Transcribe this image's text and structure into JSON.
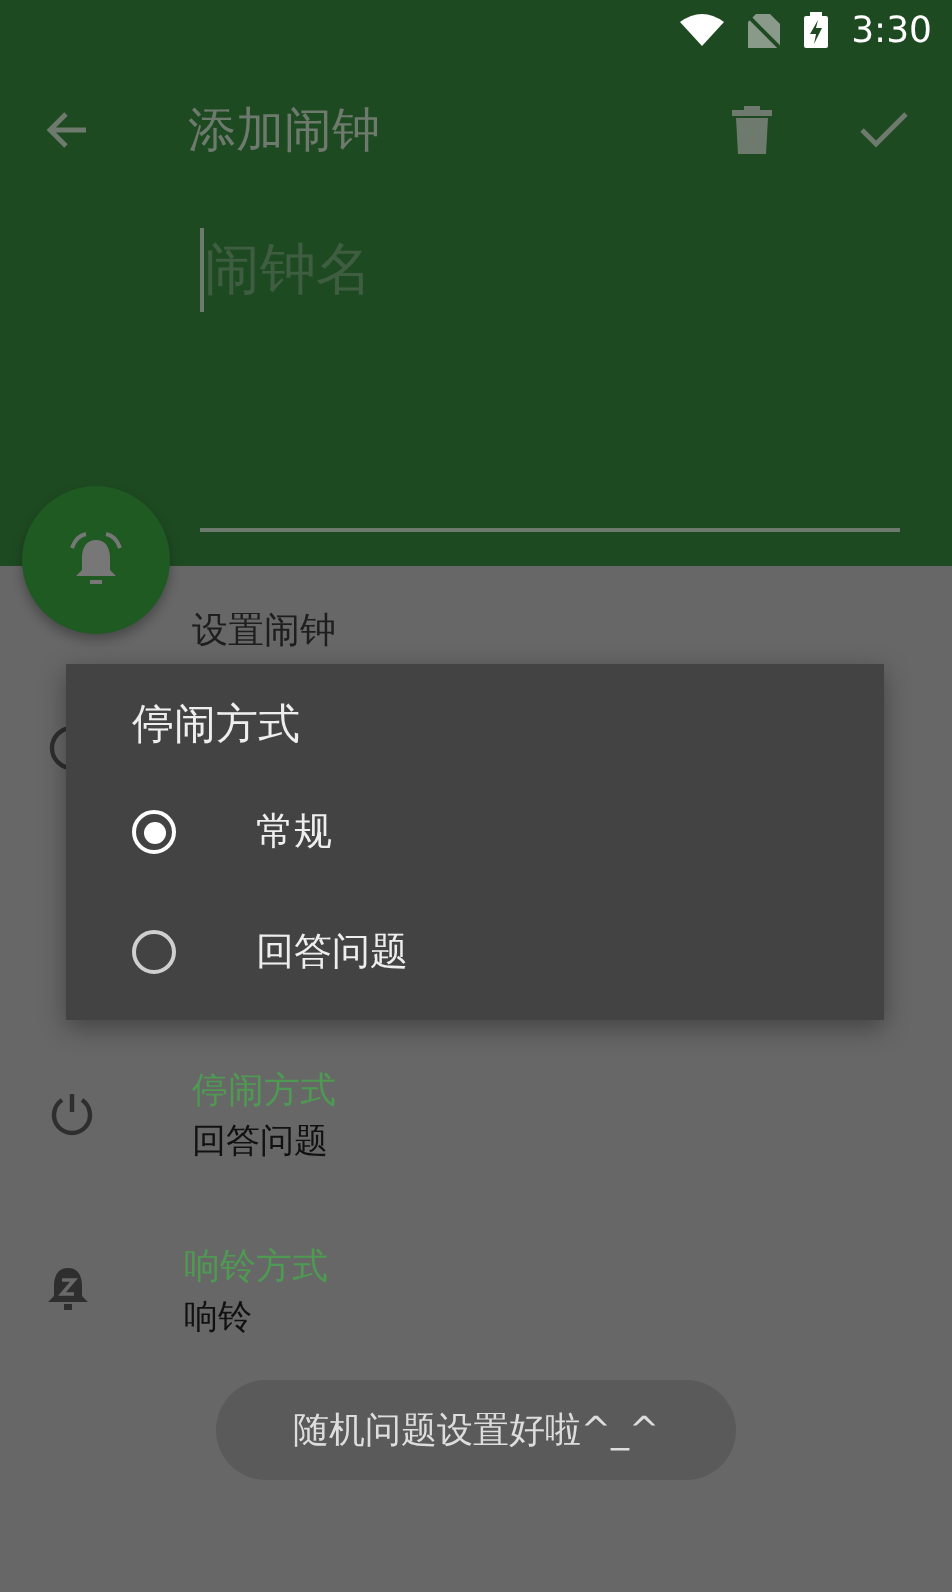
{
  "status_bar": {
    "time": "3:30"
  },
  "toolbar": {
    "title": "添加闹钟"
  },
  "name_field": {
    "placeholder": "闹钟名"
  },
  "settings": [
    {
      "kind": "header",
      "title": "设置闹钟"
    },
    {
      "kind": "option",
      "title": "停闹方式",
      "value": "回答问题"
    },
    {
      "kind": "option",
      "title": "响铃方式",
      "value": "响铃"
    }
  ],
  "dialog": {
    "title": "停闹方式",
    "options": [
      {
        "label": "常规",
        "selected": true
      },
      {
        "label": "回答问题",
        "selected": false
      }
    ]
  },
  "toast": {
    "text": "随机问题设置好啦^_^"
  }
}
